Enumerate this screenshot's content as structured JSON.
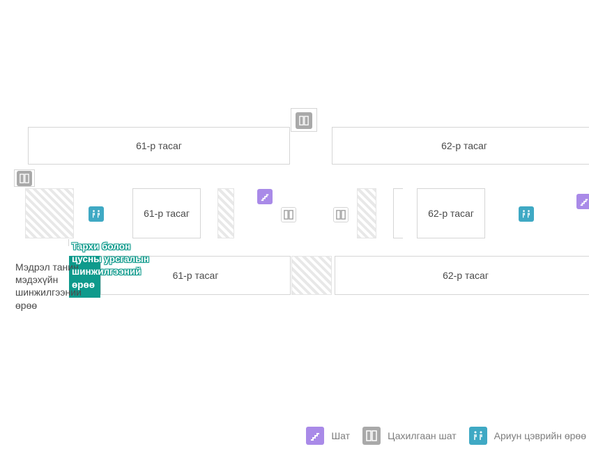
{
  "rooms": {
    "top_left": "61-р тасаг",
    "top_right": "62-р тасаг",
    "mid_left": "61-р тасаг",
    "mid_right": "62-р тасаг",
    "bot_left": "61-р тасаг",
    "bot_right": "62-р тасаг",
    "side_label": "Мэдрэл танин мэдэхүйн шинжилгээний өрөө"
  },
  "tooltip": {
    "line1": "Тархи болон",
    "line2": "цусны урсгалын",
    "line3": "шинжилгээний",
    "line4": "өрөө"
  },
  "legend": {
    "stairs": "Шат",
    "elevator": "Цахилгаан шат",
    "restroom": "Ариун цэврийн өрөө"
  },
  "icons": {
    "stairs": "stairs-icon",
    "elevator": "elevator-icon",
    "restroom": "restroom-icon"
  }
}
